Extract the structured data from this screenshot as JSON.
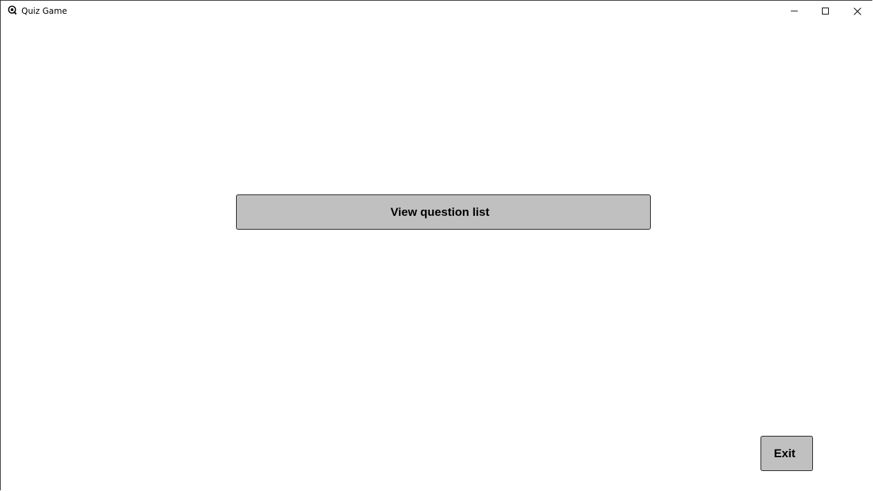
{
  "window": {
    "title": "Quiz Game",
    "icon": "quiz-app-icon",
    "controls": {
      "minimize_icon": "minimize-icon",
      "maximize_icon": "maximize-icon",
      "close_icon": "close-icon"
    }
  },
  "main": {
    "view_question_list_label": "View question list",
    "exit_label": "Exit"
  },
  "colors": {
    "background": "#ffffff",
    "button_fill": "#c0c0c0",
    "button_border": "#1a1a1a",
    "text": "#000000"
  }
}
